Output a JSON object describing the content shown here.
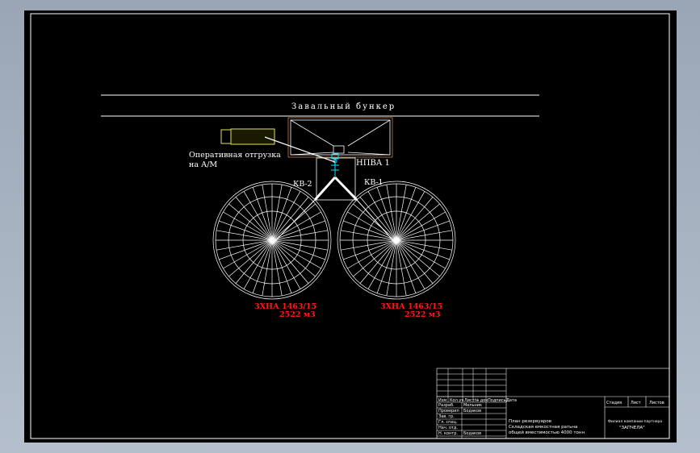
{
  "drawing": {
    "bunker_title": "Завальный бункер",
    "operative_line1": "Оперативная отгрузка",
    "operative_line2": "на А/М",
    "valve_label": "НПВА 1",
    "kv_left": "КВ-2",
    "kv_right": "КВ-1",
    "tanks": [
      {
        "name": "3ХНА 1463/15",
        "volume": "2522 м3"
      },
      {
        "name": "3ХНА 1463/15",
        "volume": "2522 м3"
      }
    ]
  },
  "title_block": {
    "header_cols": [
      "Изм",
      "Кол.уч",
      "Лист",
      "№ док",
      "Подпись",
      "Дата"
    ],
    "rows": [
      {
        "role": "Разраб.",
        "name": "Мельник"
      },
      {
        "role": "Проверил",
        "name": "Бодаков"
      },
      {
        "role": "Зав. гр.",
        "name": ""
      },
      {
        "role": "Гл. спец.",
        "name": ""
      },
      {
        "role": "Нач. отд.",
        "name": ""
      },
      {
        "role": "Н. контр.",
        "name": "Бодаков"
      }
    ],
    "description": [
      "План резервуаров",
      "Складская емкостная ратьна",
      "общей вместимостью 4000 тонн"
    ],
    "stage_headers": [
      "Стадия",
      "Лист",
      "Листов"
    ],
    "org_line1": "Филиал компании-партнера",
    "org_line2": "\"ЗАПЧЕЛА\""
  },
  "colors": {
    "background": "#000000",
    "lines": "#ffffff",
    "tank_label": "#ff1a1a",
    "valve": "#00e5ff",
    "truck": "#e0e060"
  }
}
